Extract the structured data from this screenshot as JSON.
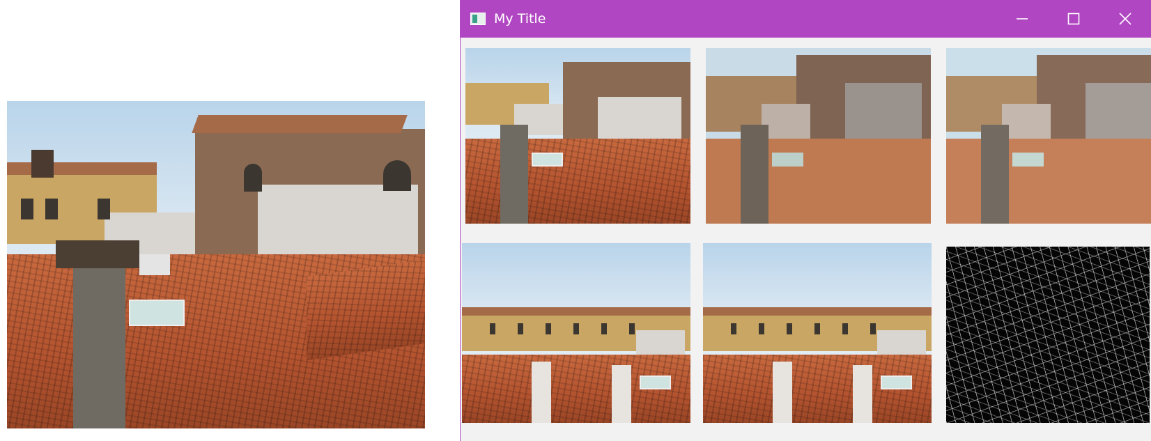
{
  "window": {
    "title": "My Title",
    "controls": {
      "minimize_icon": "minimize-icon",
      "maximize_icon": "maximize-icon",
      "close_icon": "close-icon"
    },
    "accent_color": "#b046c2"
  },
  "images": {
    "left_preview": "rooftops-original",
    "grid": [
      {
        "filter": "original"
      },
      {
        "filter": "posterized"
      },
      {
        "filter": "posterized-soft"
      },
      {
        "filter": "original-wide"
      },
      {
        "filter": "original-wide-copy"
      },
      {
        "filter": "edge-detect"
      }
    ]
  }
}
